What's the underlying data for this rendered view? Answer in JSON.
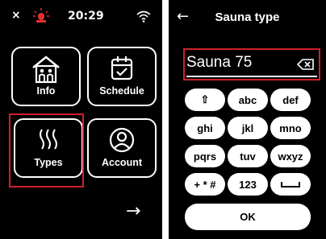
{
  "home": {
    "status": {
      "close_glyph": "×",
      "time": "20:29",
      "alert_icon": "alarm-light-icon",
      "wifi_icon": "wifi-icon"
    },
    "tiles": [
      {
        "label": "Info",
        "icon": "sauna-house-icon"
      },
      {
        "label": "Schedule",
        "icon": "calendar-check-icon"
      },
      {
        "label": "Types",
        "icon": "steam-icon"
      },
      {
        "label": "Account",
        "icon": "user-circle-icon"
      }
    ],
    "next_glyph": "→",
    "highlight_color": "#d0202a"
  },
  "keyboard_screen": {
    "back_glyph": "←",
    "title": "Sauna type",
    "input_value": "Sauna 75",
    "backspace_icon": "backspace-icon",
    "keys": [
      "⇧",
      "abc",
      "def",
      "ghi",
      "jkl",
      "mno",
      "pqrs",
      "tuv",
      "wxyz",
      "+ * #",
      "123",
      "space"
    ],
    "ok_label": "OK"
  }
}
